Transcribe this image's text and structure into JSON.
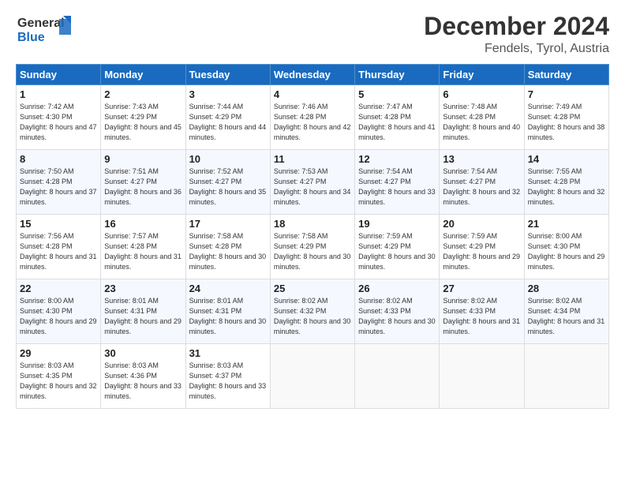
{
  "header": {
    "logo_line1": "General",
    "logo_line2": "Blue",
    "month_title": "December 2024",
    "location": "Fendels, Tyrol, Austria"
  },
  "days_of_week": [
    "Sunday",
    "Monday",
    "Tuesday",
    "Wednesday",
    "Thursday",
    "Friday",
    "Saturday"
  ],
  "weeks": [
    [
      {
        "day": "1",
        "sunrise": "Sunrise: 7:42 AM",
        "sunset": "Sunset: 4:30 PM",
        "daylight": "Daylight: 8 hours and 47 minutes."
      },
      {
        "day": "2",
        "sunrise": "Sunrise: 7:43 AM",
        "sunset": "Sunset: 4:29 PM",
        "daylight": "Daylight: 8 hours and 45 minutes."
      },
      {
        "day": "3",
        "sunrise": "Sunrise: 7:44 AM",
        "sunset": "Sunset: 4:29 PM",
        "daylight": "Daylight: 8 hours and 44 minutes."
      },
      {
        "day": "4",
        "sunrise": "Sunrise: 7:46 AM",
        "sunset": "Sunset: 4:28 PM",
        "daylight": "Daylight: 8 hours and 42 minutes."
      },
      {
        "day": "5",
        "sunrise": "Sunrise: 7:47 AM",
        "sunset": "Sunset: 4:28 PM",
        "daylight": "Daylight: 8 hours and 41 minutes."
      },
      {
        "day": "6",
        "sunrise": "Sunrise: 7:48 AM",
        "sunset": "Sunset: 4:28 PM",
        "daylight": "Daylight: 8 hours and 40 minutes."
      },
      {
        "day": "7",
        "sunrise": "Sunrise: 7:49 AM",
        "sunset": "Sunset: 4:28 PM",
        "daylight": "Daylight: 8 hours and 38 minutes."
      }
    ],
    [
      {
        "day": "8",
        "sunrise": "Sunrise: 7:50 AM",
        "sunset": "Sunset: 4:28 PM",
        "daylight": "Daylight: 8 hours and 37 minutes."
      },
      {
        "day": "9",
        "sunrise": "Sunrise: 7:51 AM",
        "sunset": "Sunset: 4:27 PM",
        "daylight": "Daylight: 8 hours and 36 minutes."
      },
      {
        "day": "10",
        "sunrise": "Sunrise: 7:52 AM",
        "sunset": "Sunset: 4:27 PM",
        "daylight": "Daylight: 8 hours and 35 minutes."
      },
      {
        "day": "11",
        "sunrise": "Sunrise: 7:53 AM",
        "sunset": "Sunset: 4:27 PM",
        "daylight": "Daylight: 8 hours and 34 minutes."
      },
      {
        "day": "12",
        "sunrise": "Sunrise: 7:54 AM",
        "sunset": "Sunset: 4:27 PM",
        "daylight": "Daylight: 8 hours and 33 minutes."
      },
      {
        "day": "13",
        "sunrise": "Sunrise: 7:54 AM",
        "sunset": "Sunset: 4:27 PM",
        "daylight": "Daylight: 8 hours and 32 minutes."
      },
      {
        "day": "14",
        "sunrise": "Sunrise: 7:55 AM",
        "sunset": "Sunset: 4:28 PM",
        "daylight": "Daylight: 8 hours and 32 minutes."
      }
    ],
    [
      {
        "day": "15",
        "sunrise": "Sunrise: 7:56 AM",
        "sunset": "Sunset: 4:28 PM",
        "daylight": "Daylight: 8 hours and 31 minutes."
      },
      {
        "day": "16",
        "sunrise": "Sunrise: 7:57 AM",
        "sunset": "Sunset: 4:28 PM",
        "daylight": "Daylight: 8 hours and 31 minutes."
      },
      {
        "day": "17",
        "sunrise": "Sunrise: 7:58 AM",
        "sunset": "Sunset: 4:28 PM",
        "daylight": "Daylight: 8 hours and 30 minutes."
      },
      {
        "day": "18",
        "sunrise": "Sunrise: 7:58 AM",
        "sunset": "Sunset: 4:29 PM",
        "daylight": "Daylight: 8 hours and 30 minutes."
      },
      {
        "day": "19",
        "sunrise": "Sunrise: 7:59 AM",
        "sunset": "Sunset: 4:29 PM",
        "daylight": "Daylight: 8 hours and 30 minutes."
      },
      {
        "day": "20",
        "sunrise": "Sunrise: 7:59 AM",
        "sunset": "Sunset: 4:29 PM",
        "daylight": "Daylight: 8 hours and 29 minutes."
      },
      {
        "day": "21",
        "sunrise": "Sunrise: 8:00 AM",
        "sunset": "Sunset: 4:30 PM",
        "daylight": "Daylight: 8 hours and 29 minutes."
      }
    ],
    [
      {
        "day": "22",
        "sunrise": "Sunrise: 8:00 AM",
        "sunset": "Sunset: 4:30 PM",
        "daylight": "Daylight: 8 hours and 29 minutes."
      },
      {
        "day": "23",
        "sunrise": "Sunrise: 8:01 AM",
        "sunset": "Sunset: 4:31 PM",
        "daylight": "Daylight: 8 hours and 29 minutes."
      },
      {
        "day": "24",
        "sunrise": "Sunrise: 8:01 AM",
        "sunset": "Sunset: 4:31 PM",
        "daylight": "Daylight: 8 hours and 30 minutes."
      },
      {
        "day": "25",
        "sunrise": "Sunrise: 8:02 AM",
        "sunset": "Sunset: 4:32 PM",
        "daylight": "Daylight: 8 hours and 30 minutes."
      },
      {
        "day": "26",
        "sunrise": "Sunrise: 8:02 AM",
        "sunset": "Sunset: 4:33 PM",
        "daylight": "Daylight: 8 hours and 30 minutes."
      },
      {
        "day": "27",
        "sunrise": "Sunrise: 8:02 AM",
        "sunset": "Sunset: 4:33 PM",
        "daylight": "Daylight: 8 hours and 31 minutes."
      },
      {
        "day": "28",
        "sunrise": "Sunrise: 8:02 AM",
        "sunset": "Sunset: 4:34 PM",
        "daylight": "Daylight: 8 hours and 31 minutes."
      }
    ],
    [
      {
        "day": "29",
        "sunrise": "Sunrise: 8:03 AM",
        "sunset": "Sunset: 4:35 PM",
        "daylight": "Daylight: 8 hours and 32 minutes."
      },
      {
        "day": "30",
        "sunrise": "Sunrise: 8:03 AM",
        "sunset": "Sunset: 4:36 PM",
        "daylight": "Daylight: 8 hours and 33 minutes."
      },
      {
        "day": "31",
        "sunrise": "Sunrise: 8:03 AM",
        "sunset": "Sunset: 4:37 PM",
        "daylight": "Daylight: 8 hours and 33 minutes."
      },
      null,
      null,
      null,
      null
    ]
  ]
}
